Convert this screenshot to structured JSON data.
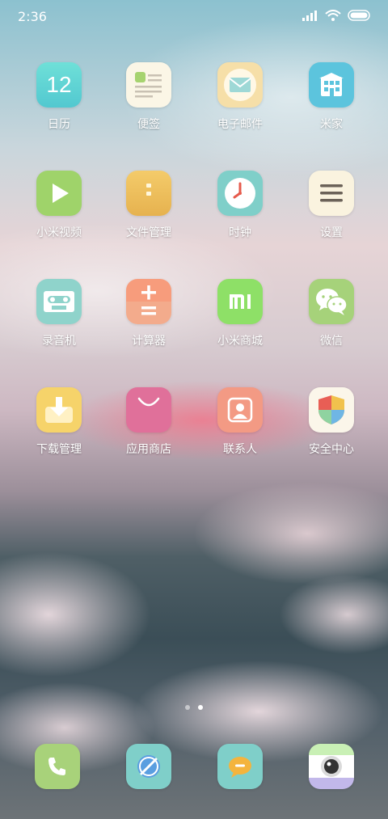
{
  "status_bar": {
    "time": "2:36"
  },
  "apps": [
    {
      "id": "calendar",
      "label": "日历",
      "day": "12"
    },
    {
      "id": "notes",
      "label": "便签"
    },
    {
      "id": "email",
      "label": "电子邮件"
    },
    {
      "id": "mihome",
      "label": "米家"
    },
    {
      "id": "mivideo",
      "label": "小米视频"
    },
    {
      "id": "filemanager",
      "label": "文件管理"
    },
    {
      "id": "clock",
      "label": "时钟"
    },
    {
      "id": "settings",
      "label": "设置"
    },
    {
      "id": "recorder",
      "label": "录音机"
    },
    {
      "id": "calculator",
      "label": "计算器"
    },
    {
      "id": "mistore",
      "label": "小米商城"
    },
    {
      "id": "wechat",
      "label": "微信"
    },
    {
      "id": "downloads",
      "label": "下载管理"
    },
    {
      "id": "appstore",
      "label": "应用商店"
    },
    {
      "id": "contacts",
      "label": "联系人"
    },
    {
      "id": "security",
      "label": "安全中心"
    }
  ],
  "dock": [
    {
      "id": "phone",
      "icon": "phone-icon"
    },
    {
      "id": "browser",
      "icon": "browser-icon"
    },
    {
      "id": "messages",
      "icon": "message-icon"
    },
    {
      "id": "camera",
      "icon": "camera-icon"
    }
  ],
  "pages": {
    "count": 2,
    "current": 2
  }
}
